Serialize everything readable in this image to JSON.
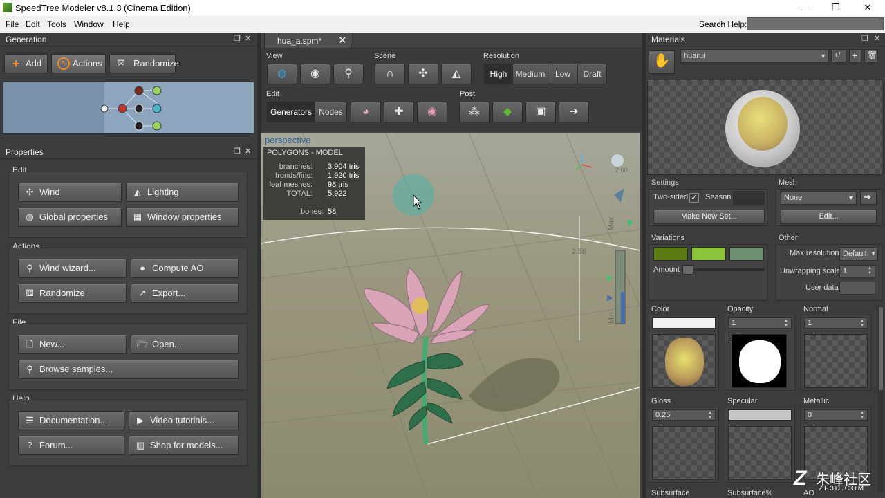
{
  "window": {
    "title": "SpeedTree Modeler v8.1.3 (Cinema Edition)",
    "minimize": "—",
    "maximize": "❐",
    "close": "✕"
  },
  "menu": {
    "items": [
      "File",
      "Edit",
      "Tools",
      "Window",
      "Help"
    ],
    "search_label": "Search Help:"
  },
  "generation": {
    "title": "Generation",
    "add": "Add",
    "actions": "Actions",
    "randomize": "Randomize"
  },
  "properties": {
    "title": "Properties",
    "edit_label": "Edit",
    "wind": "Wind",
    "lighting": "Lighting",
    "global_properties": "Global properties",
    "window_properties": "Window properties",
    "actions_label": "Actions",
    "wind_wizard": "Wind wizard...",
    "compute_ao": "Compute AO",
    "randomize": "Randomize",
    "export": "Export...",
    "file_label": "File",
    "new": "New...",
    "open": "Open...",
    "browse_samples": "Browse samples...",
    "help_label": "Help",
    "documentation": "Documentation...",
    "video_tutorials": "Video tutorials...",
    "forum": "Forum...",
    "shop": "Shop for models..."
  },
  "document": {
    "tab": "hua_a.spm*",
    "close": "✕"
  },
  "toolbar": {
    "view_label": "View",
    "scene_label": "Scene",
    "resolution_label": "Resolution",
    "resolution": [
      "High",
      "Medium",
      "Low",
      "Draft"
    ],
    "edit_label": "Edit",
    "generators": "Generators",
    "nodes": "Nodes",
    "post_label": "Post"
  },
  "viewport": {
    "camera": "perspective",
    "stats_title": "POLYGONS - MODEL",
    "stats": [
      {
        "label": "branches:",
        "value": "3,904 tris"
      },
      {
        "label": "fronds/fins:",
        "value": "1,920 tris"
      },
      {
        "label": "leaf meshes:",
        "value": "98 tris"
      },
      {
        "label": "TOTAL:",
        "value": "5,922"
      },
      {
        "label": "bones:",
        "value": "58"
      }
    ],
    "grid_label": "2.55",
    "light_value": "2.00",
    "slider_max": "Max",
    "slider_min": "Min"
  },
  "materials": {
    "title": "Materials",
    "selected": "huarui",
    "plus_slash": "+/",
    "settings_label": "Settings",
    "two_sided": "Two-sided",
    "season": "Season",
    "make_new_set": "Make New Set...",
    "mesh_label": "Mesh",
    "mesh_value": "None",
    "edit_btn": "Edit...",
    "variations_label": "Variations",
    "amount": "Amount",
    "other_label": "Other",
    "max_resolution": "Max resolution",
    "max_resolution_value": "Default",
    "unwrapping_scale": "Unwrapping scale",
    "unwrapping_value": "1",
    "user_data": "User data",
    "color": "Color",
    "opacity": "Opacity",
    "opacity_value": "1",
    "normal": "Normal",
    "normal_value": "1",
    "gloss": "Gloss",
    "gloss_value": "0.25",
    "specular": "Specular",
    "metallic": "Metallic",
    "metallic_value": "0",
    "subsurface": "Subsurface",
    "subsurface_pct": "Subsurface%",
    "ao": "AO",
    "variation_colors": [
      "#5c7a12",
      "#8cc43c",
      "#6f8f72"
    ]
  },
  "watermark": {
    "text": "朱峰社区",
    "sub": "ZF3D.COM"
  }
}
